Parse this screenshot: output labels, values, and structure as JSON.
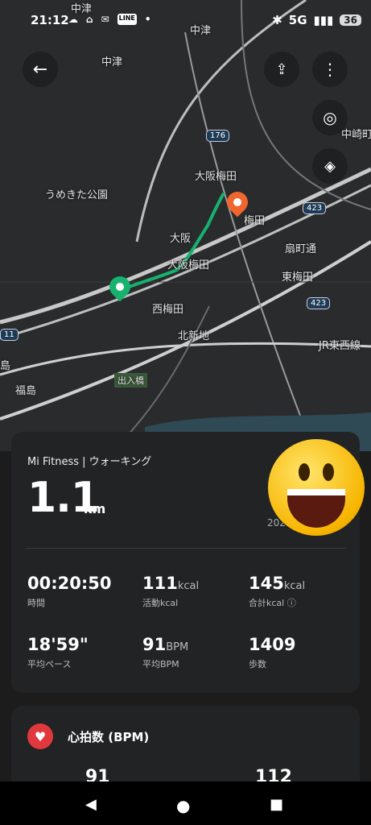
{
  "status": {
    "time": "21:12",
    "network": "5G",
    "battery": "36",
    "line_label": "LINE"
  },
  "map": {
    "labels": [
      {
        "text": "中津",
        "id": "nakatsu-top"
      },
      {
        "text": "中津",
        "id": "nakatsu-left"
      },
      {
        "text": "中津",
        "id": "nakatsu-right"
      },
      {
        "text": "中崎町",
        "id": "nakazakicho"
      },
      {
        "text": "うめきた公園",
        "id": "umekita-park"
      },
      {
        "text": "大阪梅田",
        "id": "osaka-umeda-1"
      },
      {
        "text": "梅田",
        "id": "umeda"
      },
      {
        "text": "大阪",
        "id": "osaka"
      },
      {
        "text": "扇町通",
        "id": "ogimachi-dori"
      },
      {
        "text": "大阪梅田",
        "id": "osaka-umeda-2"
      },
      {
        "text": "東梅田",
        "id": "higashi-umeda"
      },
      {
        "text": "西梅田",
        "id": "nishi-umeda"
      },
      {
        "text": "北新地",
        "id": "kitashinchi"
      },
      {
        "text": "JR東西線",
        "id": "jr-tozai"
      },
      {
        "text": "島",
        "id": "shima"
      },
      {
        "text": "福島",
        "id": "fukushima"
      },
      {
        "text": "出入橋",
        "id": "deirihashi"
      }
    ],
    "road_badges": [
      "176",
      "423",
      "423",
      "11"
    ]
  },
  "workout": {
    "source": "Mi Fitness | ウォーキング",
    "distance": "1.1",
    "distance_unit": "km",
    "date_partial": "202",
    "stats": [
      {
        "value": "00:20:50",
        "unit": "",
        "label": "時間"
      },
      {
        "value": "111",
        "unit": "kcal",
        "label": "活動kcal"
      },
      {
        "value": "145",
        "unit": "kcal",
        "label": "合計kcal ⓘ"
      },
      {
        "value": "18'59\"",
        "unit": "",
        "label": "平均ペース"
      },
      {
        "value": "91",
        "unit": "BPM",
        "label": "平均BPM"
      },
      {
        "value": "1409",
        "unit": "",
        "label": "歩数"
      }
    ]
  },
  "heart": {
    "title": "心拍数 (BPM)",
    "values": [
      "91",
      "112"
    ]
  },
  "colors": {
    "route": "#16b26e",
    "start_pin": "#16b26e",
    "end_pin": "#f0662e",
    "heart": "#e0383c"
  }
}
